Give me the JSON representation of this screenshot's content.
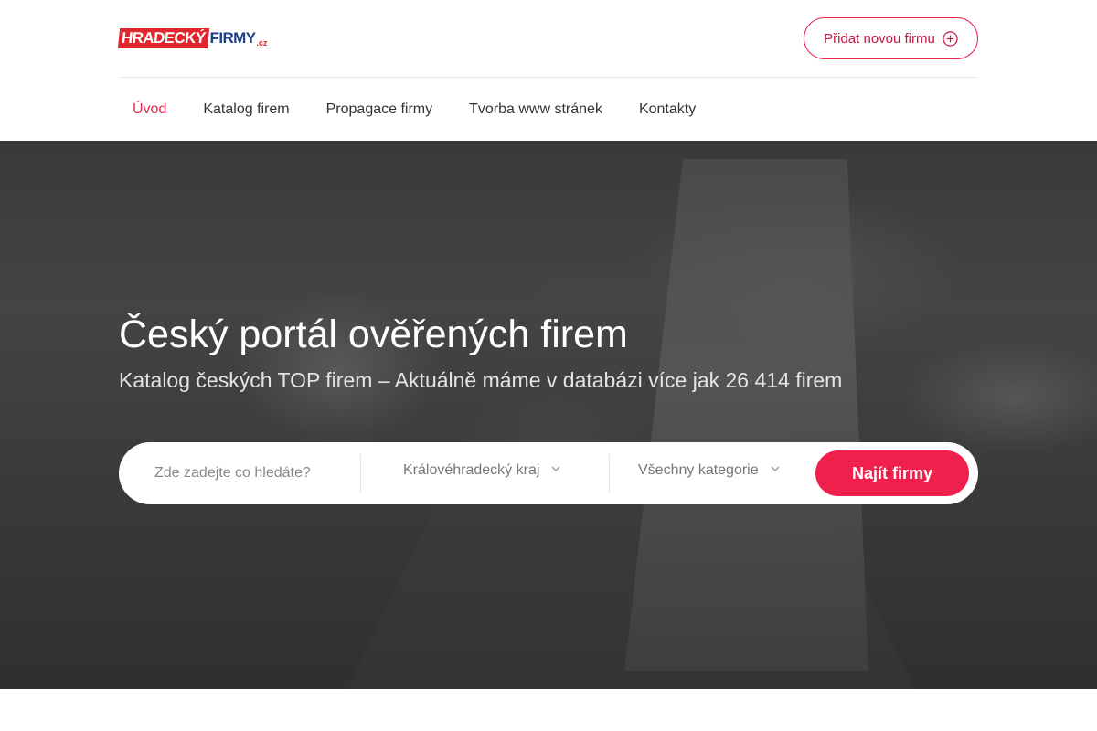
{
  "header": {
    "logo": {
      "part1": "HRADECKÝ",
      "part2": "FIRMY",
      "part3": ".cz"
    },
    "add_company_label": "Přidat novou firmu"
  },
  "nav": {
    "items": [
      {
        "label": "Úvod",
        "active": true
      },
      {
        "label": "Katalog firem",
        "active": false
      },
      {
        "label": "Propagace firmy",
        "active": false
      },
      {
        "label": "Tvorba www stránek",
        "active": false
      },
      {
        "label": "Kontakty",
        "active": false
      }
    ]
  },
  "hero": {
    "title": "Český portál ověřených firem",
    "subtitle": "Katalog českých TOP firem – Aktuálně máme v databázi více jak 26 414 firem"
  },
  "search": {
    "placeholder": "Zde zadejte co hledáte?",
    "value": "",
    "region_selected": "Královéhradecký kraj",
    "category_selected": "Všechny kategorie",
    "submit_label": "Najít firmy"
  },
  "colors": {
    "accent": "#f0204d",
    "accent_text": "#c8163d",
    "logo_red": "#e0262e",
    "logo_blue": "#1c3f85"
  },
  "icons": {
    "add": "plus-circle-icon",
    "dropdown": "chevron-down-icon"
  }
}
